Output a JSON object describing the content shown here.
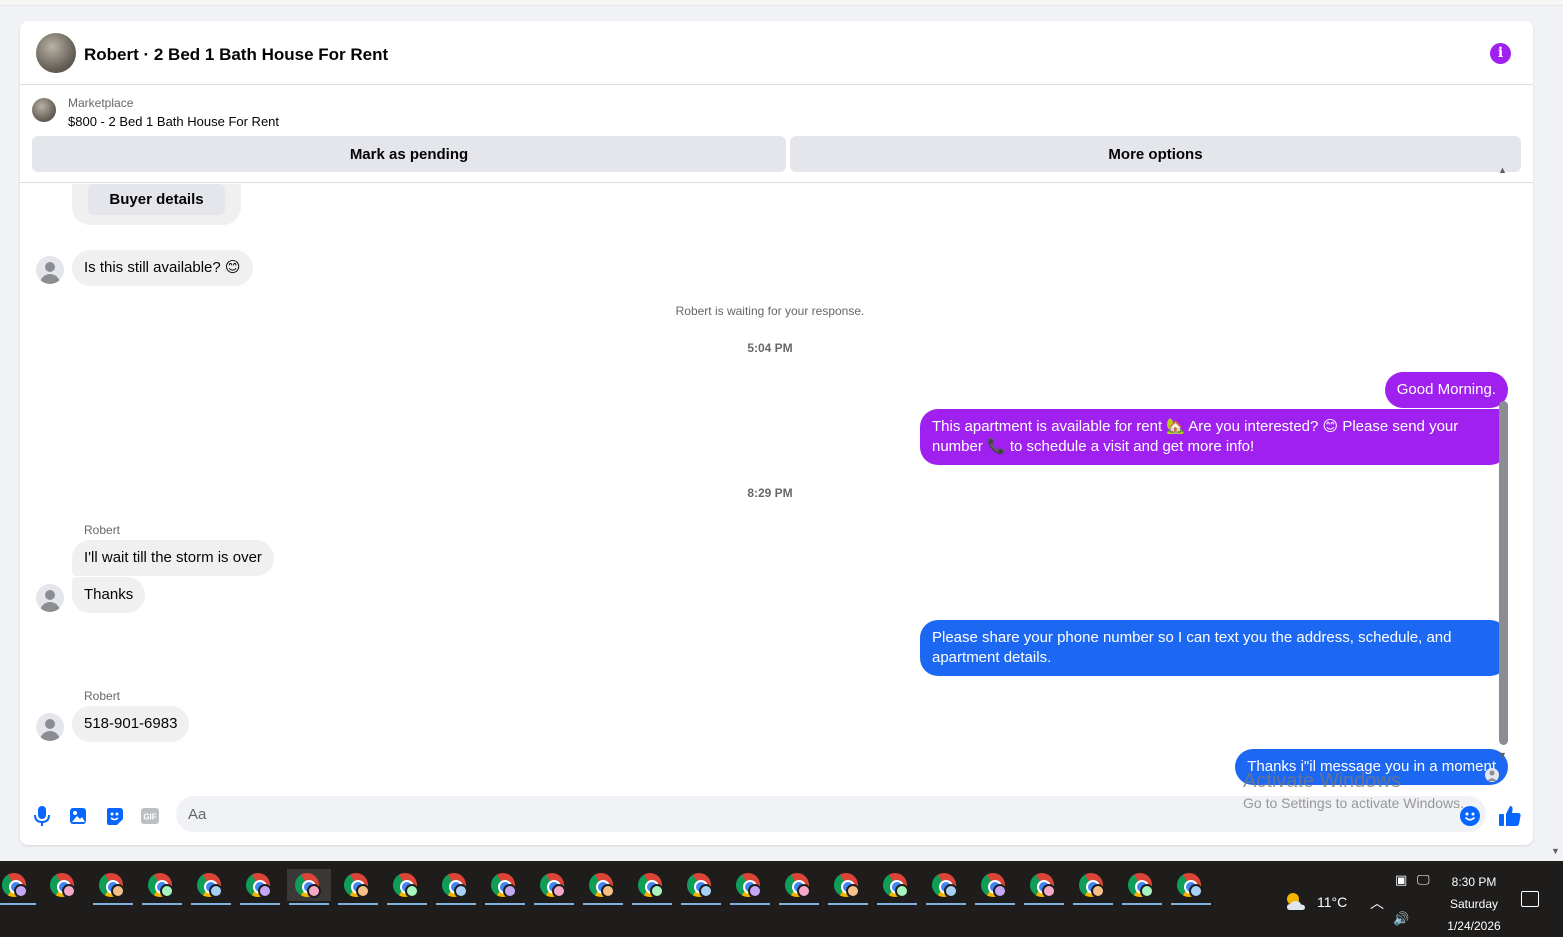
{
  "header": {
    "title": "Robert · 2 Bed 1 Bath House For Rent",
    "info_icon": "info-icon",
    "accent_color": "#a020f0"
  },
  "marketplace": {
    "label": "Marketplace",
    "listing": "$800 - 2 Bed 1 Bath House For Rent",
    "pending_button": "Mark as pending",
    "more_button": "More options"
  },
  "thread": {
    "buyer_details": "Buyer details",
    "first_message": "Is this still available? 😊",
    "waiting_note": "Robert is waiting for your response.",
    "time_1": "5:04 PM",
    "out_1": "Good Morning.",
    "out_2": "This apartment is available for rent 🏡 Are you interested? 😊 Please send your number 📞 to schedule a visit and get more info!",
    "time_2": "8:29 PM",
    "sender_1": "Robert",
    "in_2": "I'll wait till the storm is over",
    "in_3": "Thanks",
    "out_3": "Please share your phone number so I can text you the address, schedule, and apartment details.",
    "sender_2": "Robert",
    "in_4": "518-901-6983",
    "out_4": "Thanks i\"il message you in a moment"
  },
  "composer": {
    "placeholder": "Aa",
    "icons": [
      "microphone-icon",
      "photo-icon",
      "sticker-icon",
      "gif-icon",
      "emoji-icon",
      "thumbs-up-icon"
    ],
    "gif_label": "GIF"
  },
  "watermark": {
    "line1": "Activate Windows",
    "line2": "Go to Settings to activate Windows."
  },
  "taskbar": {
    "app_count": 25,
    "active_index": 6,
    "weather_temp": "11°C",
    "time": "8:30 PM",
    "day": "Saturday",
    "date": "1/24/2026"
  }
}
